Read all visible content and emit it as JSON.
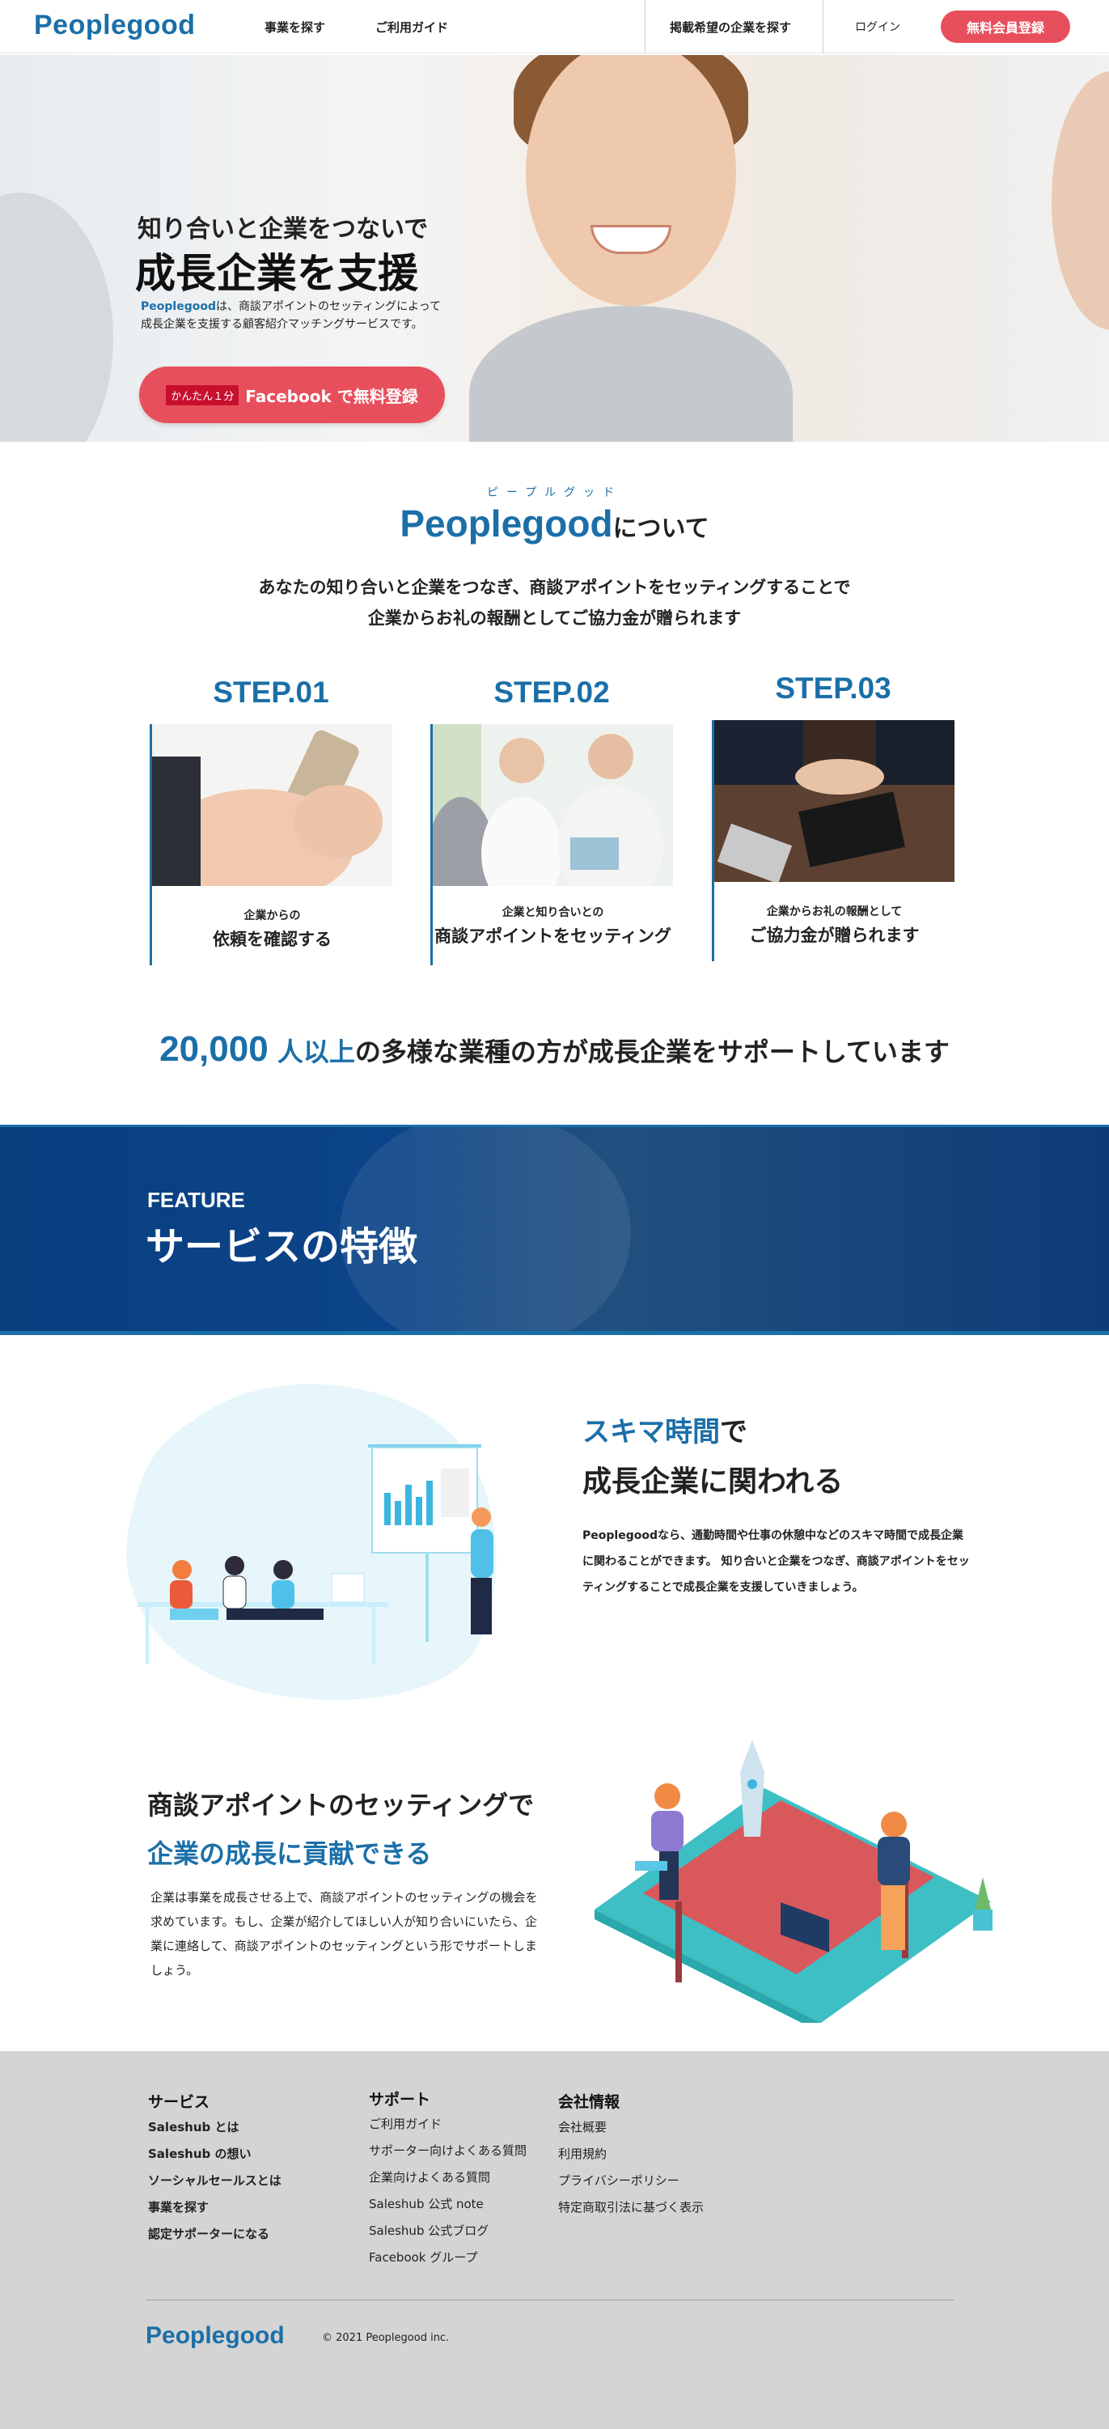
{
  "colors": {
    "brand": "#1b6fa8",
    "accent": "#e84f5c",
    "banner": "#0b4488",
    "footer": "#d4d4d4"
  },
  "header": {
    "logo": "Peoplegood",
    "nav": [
      "事業を探す",
      "ご利用ガイド",
      "掲載希望の企業を探す"
    ],
    "login": "ログイン",
    "signup": "無料会員登録"
  },
  "hero": {
    "subtitle": "知り合いと企業をつないで",
    "title": "成長企業を支援",
    "desc_brand": "Peoplegood",
    "desc_line1": "は、商談アポイントのセッティングによって",
    "desc_line2": "成長企業を支援する顧客紹介マッチングサービスです。",
    "cta_tag": "かんたん１分",
    "cta_text": "Facebook で無料登録"
  },
  "about": {
    "ruby": "ピープルグッド",
    "brand": "Peoplegood",
    "suffix": "について",
    "line1": "あなたの知り合いと企業をつなぎ、商談アポイントをセッティングすることで",
    "line2": "企業からお礼の報酬としてご協力金が贈られます"
  },
  "steps": [
    {
      "label": "STEP.01",
      "small": "企業からの",
      "big": "依頼を確認する"
    },
    {
      "label": "STEP.02",
      "small": "企業と知り合いとの",
      "big": "商談アポイントをセッティング"
    },
    {
      "label": "STEP.03",
      "small": "企業からお礼の報酬として",
      "big": "ご協力金が贈られます"
    }
  ],
  "stat": {
    "num": "20,000",
    "unit": " 人以上",
    "rest": "の多様な業種の方が成長企業をサポートしています"
  },
  "feature_banner": {
    "kicker": "FEATURE",
    "title": "サービスの特徴"
  },
  "feature1": {
    "head_hl": "スキマ時間",
    "head_rest": "で",
    "head2": "成長企業に関われる",
    "body": "Peoplegoodなら、通勤時間や仕事の休憩中などのスキマ時間で成長企業に関わることができます。 知り合いと企業をつなぎ、商談アポイントをセッティングすることで成長企業を支援していきましょう。"
  },
  "feature2": {
    "head1": "商談アポイントのセッティングで",
    "head2": "企業の成長に貢献できる",
    "body": "企業は事業を成長させる上で、商談アポイントのセッティングの機会を求めています。もし、企業が紹介してほしい人が知り合いにいたら、企業に連絡して、商談アポイントのセッティングという形でサポートしましょう。"
  },
  "footer": {
    "col1_title": "サービス",
    "col1": [
      "Saleshub とは",
      "Saleshub の想い",
      "ソーシャルセールスとは",
      "事業を探す",
      "認定サポーターになる"
    ],
    "col2_title": "サポート",
    "col2": [
      "ご利用ガイド",
      "サポーター向けよくある質問",
      "企業向けよくある質問",
      "Saleshub 公式 note",
      "Saleshub 公式ブログ",
      "Facebook グループ"
    ],
    "col3_title": "会社情報",
    "col3": [
      "会社概要",
      "利用規約",
      "プライバシーポリシー",
      "特定商取引法に基づく表示"
    ],
    "logo": "Peoplegood",
    "copyright": "© 2021 Peoplegood inc."
  }
}
